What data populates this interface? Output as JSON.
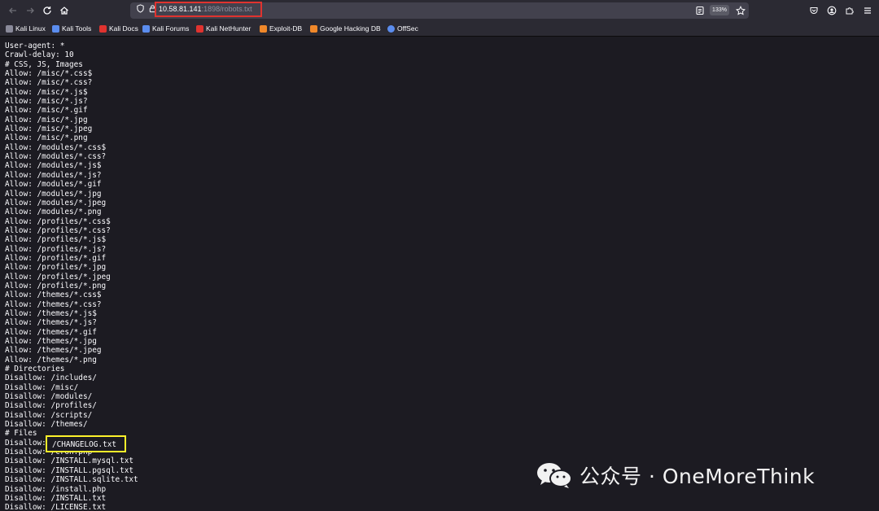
{
  "browser": {
    "url": {
      "host": "10.58.81.141",
      "rest": ":1898/robots.txt"
    },
    "zoom": "133%"
  },
  "bookmarks": [
    {
      "label": "Kali Linux",
      "icon": "kali-dragon-icon",
      "color": "#8a8a9a"
    },
    {
      "label": "Kali Tools",
      "icon": "kali-tools-icon",
      "color": "#5b8def"
    },
    {
      "label": "Kali Docs",
      "icon": "kali-docs-icon",
      "color": "#e0332f"
    },
    {
      "label": "Kali Forums",
      "icon": "kali-forums-icon",
      "color": "#5b8def"
    },
    {
      "label": "Kali NetHunter",
      "icon": "nethunter-icon",
      "color": "#e0332f"
    },
    {
      "label": "Exploit-DB",
      "icon": "exploit-db-icon",
      "color": "#f0882a"
    },
    {
      "label": "Google Hacking DB",
      "icon": "ghdb-icon",
      "color": "#f0882a"
    },
    {
      "label": "OffSec",
      "icon": "offsec-icon",
      "color": "#5b8def"
    }
  ],
  "robots": {
    "lines": [
      "User-agent: *",
      "Crawl-delay: 10",
      "# CSS, JS, Images",
      "Allow: /misc/*.css$",
      "Allow: /misc/*.css?",
      "Allow: /misc/*.js$",
      "Allow: /misc/*.js?",
      "Allow: /misc/*.gif",
      "Allow: /misc/*.jpg",
      "Allow: /misc/*.jpeg",
      "Allow: /misc/*.png",
      "Allow: /modules/*.css$",
      "Allow: /modules/*.css?",
      "Allow: /modules/*.js$",
      "Allow: /modules/*.js?",
      "Allow: /modules/*.gif",
      "Allow: /modules/*.jpg",
      "Allow: /modules/*.jpeg",
      "Allow: /modules/*.png",
      "Allow: /profiles/*.css$",
      "Allow: /profiles/*.css?",
      "Allow: /profiles/*.js$",
      "Allow: /profiles/*.js?",
      "Allow: /profiles/*.gif",
      "Allow: /profiles/*.jpg",
      "Allow: /profiles/*.jpeg",
      "Allow: /profiles/*.png",
      "Allow: /themes/*.css$",
      "Allow: /themes/*.css?",
      "Allow: /themes/*.js$",
      "Allow: /themes/*.js?",
      "Allow: /themes/*.gif",
      "Allow: /themes/*.jpg",
      "Allow: /themes/*.jpeg",
      "Allow: /themes/*.png",
      "# Directories",
      "Disallow: /includes/",
      "Disallow: /misc/",
      "Disallow: /modules/",
      "Disallow: /profiles/",
      "Disallow: /scripts/",
      "Disallow: /themes/",
      "# Files",
      "Disallow: /CHANGELOG.txt",
      "Disallow: /cron.php",
      "Disallow: /INSTALL.mysql.txt",
      "Disallow: /INSTALL.pgsql.txt",
      "Disallow: /INSTALL.sqlite.txt",
      "Disallow: /install.php",
      "Disallow: /INSTALL.txt",
      "Disallow: /LICENSE.txt"
    ],
    "highlighted_entry": "/CHANGELOG.txt"
  },
  "watermark": {
    "text": "公众号 · OneMoreThink"
  },
  "colors": {
    "url_highlight": "#e0332f",
    "entry_highlight": "#fdf12a"
  }
}
